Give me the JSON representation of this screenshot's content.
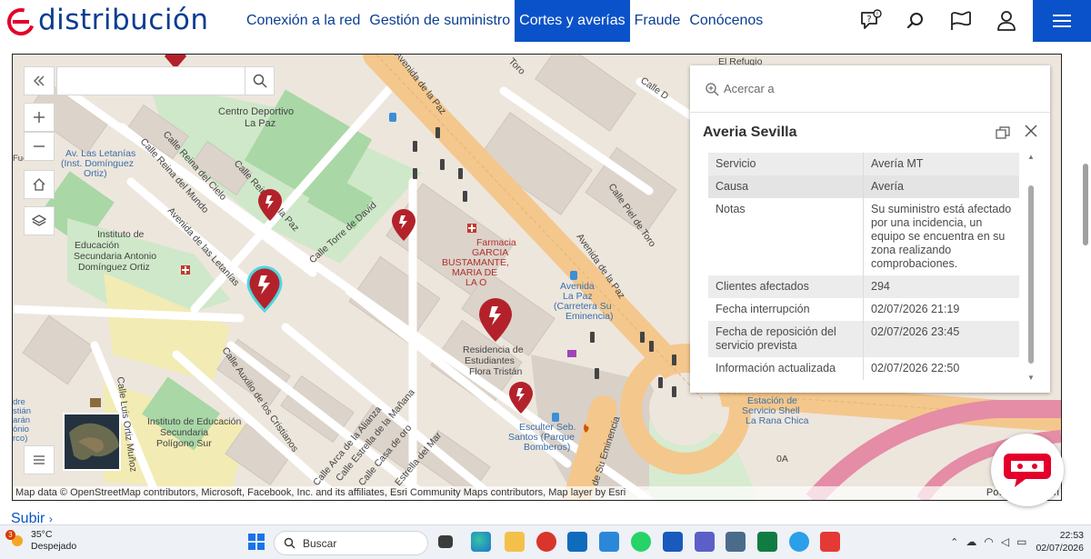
{
  "header": {
    "brand": "distribución",
    "nav": [
      {
        "label": "Conexión a la red",
        "active": false
      },
      {
        "label": "Gestión de suministro",
        "active": false
      },
      {
        "label": "Cortes y averías",
        "active": true
      },
      {
        "label": "Fraude",
        "active": false
      },
      {
        "label": "Conócenos",
        "active": false
      }
    ],
    "icons": [
      "help-chat-icon",
      "search-icon",
      "flag-icon",
      "user-icon",
      "menu-icon"
    ],
    "accent": "#0a52c9",
    "brand_color": "#0a3d91",
    "logo_accent": "#e4002b"
  },
  "map": {
    "search_placeholder": "",
    "street_labels": {
      "centro_deportivo": "Centro Deportivo La Paz",
      "av_letanias_inst": "Av. Las Letanías (Inst. Domínguez Ortiz)",
      "instituto_1": "Instituto de Educación Secundaria Antonio Domínguez Ortiz",
      "calle_reina_paz": "Calle Reina de la Paz",
      "calle_reina_cielo": "Calle Reina del Cielo",
      "calle_reina_mundo": "Calle Reina del Mundo",
      "avenida_letanias": "Avenida de las Letanías",
      "calle_torre_david": "Calle Torre de David",
      "farmacia": "Farmacia GARCIA BUSTAMANTE, MARIA DE LA O",
      "avenida_paz_top": "Avenida de la Paz",
      "avenida_paz_right": "Avenida de la Paz",
      "calle_piel_toro": "Calle Piel de Toro",
      "calle_toro": "Toro",
      "calle_d": "Calle D",
      "el_refugio": "El Refugio",
      "avenida_la_paz_stop": "Avenida La Paz (Carretera Su Eminencia)",
      "residencia": "Residencia de Estudiantes Flora Tristán",
      "calle_auxilio": "Calle Auxilio de los Cristianos",
      "calle_estrella_manana": "Calle Estrella de la Mañana",
      "calle_arca_alianza": "Calle Arca de la Alianza",
      "calle_casa_oro": "Calle Casa de oro",
      "calle_estrella_mar": "Estrella del Mar",
      "calle_luis_ortiz": "Calle Luis Ortiz Muñoz",
      "instituto_2": "Instituto de Educación Secundaria Polígono Sur",
      "esculter": "Esculter Seb. Santos (Parque Bomberos)",
      "estacion": "Estación de Servicio Shell La Rana Chica",
      "su_eminencia": "de Su Eminencia",
      "zero_a": "0A",
      "left_fuente": "Fuentes",
      "left_edge": "dre stián arán ónio rco)"
    },
    "attribution": "Map data © OpenStreetMap contributors, Microsoft, Facebook, Inc. and its affiliates, Esri Community Maps contributors, Map layer by Esri",
    "powered": "Powered by Esri"
  },
  "popup": {
    "zoom_label": "Acercar a",
    "title": "Averia Sevilla",
    "rows": [
      {
        "key": "Servicio",
        "value": "Avería MT"
      },
      {
        "key": "Causa",
        "value": "Avería"
      },
      {
        "key": "Notas",
        "value": "Su suministro está afectado por una incidencia, un equipo se encuentra en su zona realizando comprobaciones."
      },
      {
        "key": "Clientes afectados",
        "value": "294"
      },
      {
        "key": "Fecha interrupción",
        "value": "02/07/2026 21:19"
      },
      {
        "key": "Fecha de reposición del servicio prevista",
        "value": "02/07/2026 23:45"
      },
      {
        "key": "Información actualizada",
        "value": "02/07/2026 22:50"
      }
    ]
  },
  "page": {
    "subir": "Subir"
  },
  "taskbar": {
    "weather_badge": "3",
    "temperature": "35°C",
    "weather_desc": "Despejado",
    "search_label": "Buscar",
    "time": "22:53",
    "date": "02/07/2026"
  }
}
